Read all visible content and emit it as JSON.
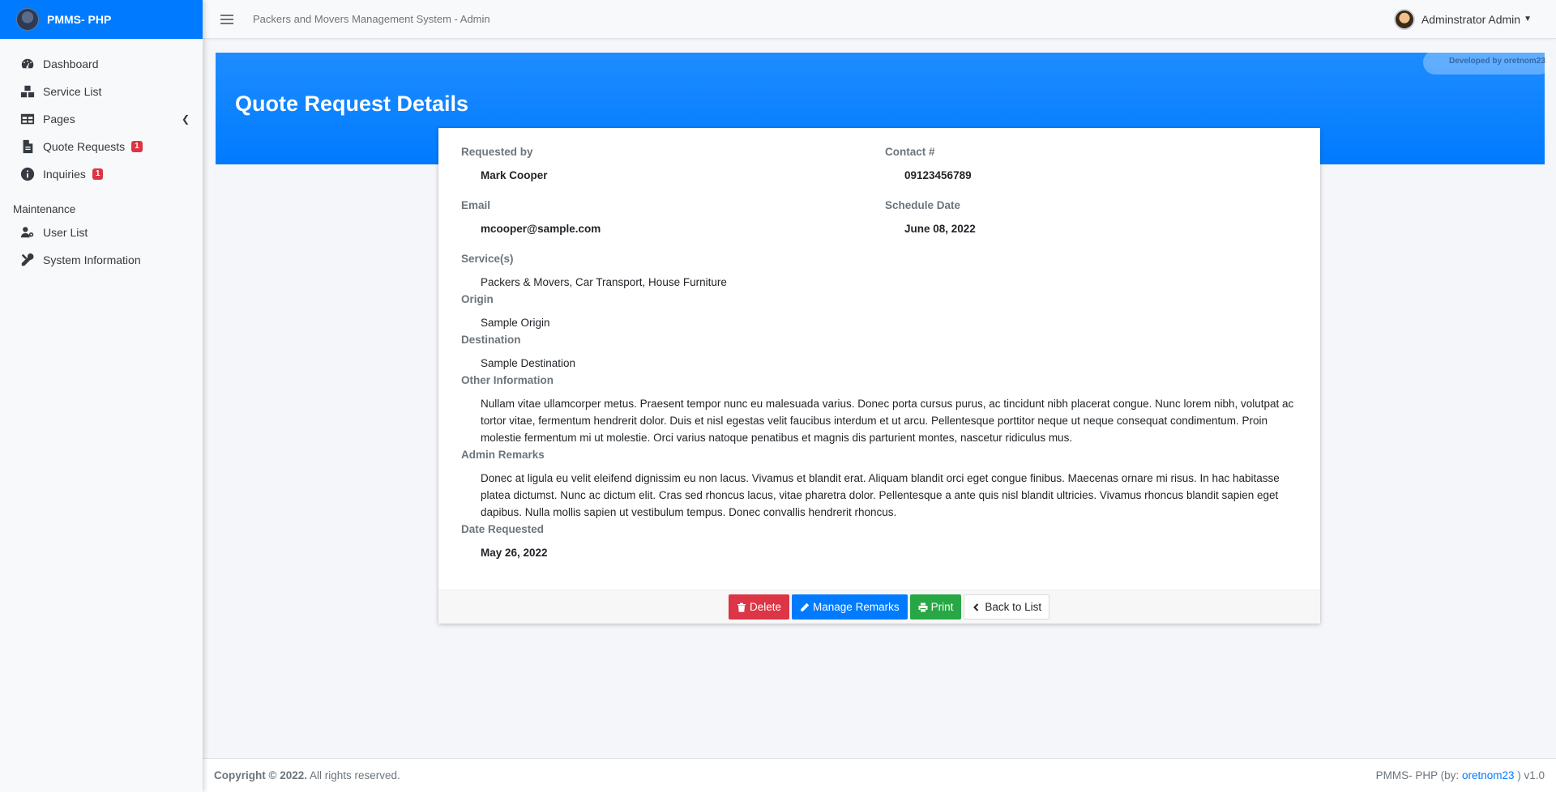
{
  "brand": {
    "name": "PMMS- PHP"
  },
  "sidebar": {
    "items": [
      {
        "label": "Dashboard",
        "icon": "dashboard-icon"
      },
      {
        "label": "Service List",
        "icon": "boxes-icon"
      },
      {
        "label": "Pages",
        "icon": "table-icon"
      },
      {
        "label": "Quote Requests",
        "icon": "file-icon",
        "badge": "1"
      },
      {
        "label": "Inquiries",
        "icon": "info-icon",
        "badge": "1"
      }
    ],
    "section_header": "Maintenance",
    "maintenance_items": [
      {
        "label": "User List",
        "icon": "users-cog-icon"
      },
      {
        "label": "System Information",
        "icon": "tools-icon"
      }
    ]
  },
  "topbar": {
    "system_title": "Packers and Movers Management System - Admin",
    "user_name": "Adminstrator Admin"
  },
  "header": {
    "title": "Quote Request Details",
    "developed_by": "Developed by oretnom23"
  },
  "details": {
    "requested_by_label": "Requested by",
    "requested_by": "Mark Cooper",
    "contact_label": "Contact #",
    "contact": "09123456789",
    "email_label": "Email",
    "email": "mcooper@sample.com",
    "schedule_label": "Schedule Date",
    "schedule": "June 08, 2022",
    "services_label": "Service(s)",
    "services": "Packers & Movers, Car Transport, House Furniture",
    "origin_label": "Origin",
    "origin": "Sample Origin",
    "destination_label": "Destination",
    "destination": "Sample Destination",
    "other_info_label": "Other Information",
    "other_info": "Nullam vitae ullamcorper metus. Praesent tempor nunc eu malesuada varius. Donec porta cursus purus, ac tincidunt nibh placerat congue. Nunc lorem nibh, volutpat ac tortor vitae, fermentum hendrerit dolor. Duis et nisl egestas velit faucibus interdum et ut arcu. Pellentesque porttitor neque ut neque consequat condimentum. Proin molestie fermentum mi ut molestie. Orci varius natoque penatibus et magnis dis parturient montes, nascetur ridiculus mus.",
    "admin_remarks_label": "Admin Remarks",
    "admin_remarks": "Donec at ligula eu velit eleifend dignissim eu non lacus. Vivamus et blandit erat. Aliquam blandit orci eget congue finibus. Maecenas ornare mi risus. In hac habitasse platea dictumst. Nunc ac dictum elit. Cras sed rhoncus lacus, vitae pharetra dolor. Pellentesque a ante quis nisl blandit ultricies. Vivamus rhoncus blandit sapien eget dapibus. Nulla mollis sapien ut vestibulum tempus. Donec convallis hendrerit rhoncus.",
    "date_requested_label": "Date Requested",
    "date_requested": "May 26, 2022"
  },
  "actions": {
    "delete": "Delete",
    "manage_remarks": "Manage Remarks",
    "print": "Print",
    "back": "Back to List"
  },
  "footer": {
    "copyright_bold": "Copyright © 2022.",
    "copyright_rest": " All rights reserved.",
    "app_prefix": "PMMS- PHP (by: ",
    "author": "oretnom23",
    "app_suffix": " ) v1.0"
  },
  "colors": {
    "primary": "#007bff",
    "danger": "#dc3545",
    "success": "#28a745"
  }
}
